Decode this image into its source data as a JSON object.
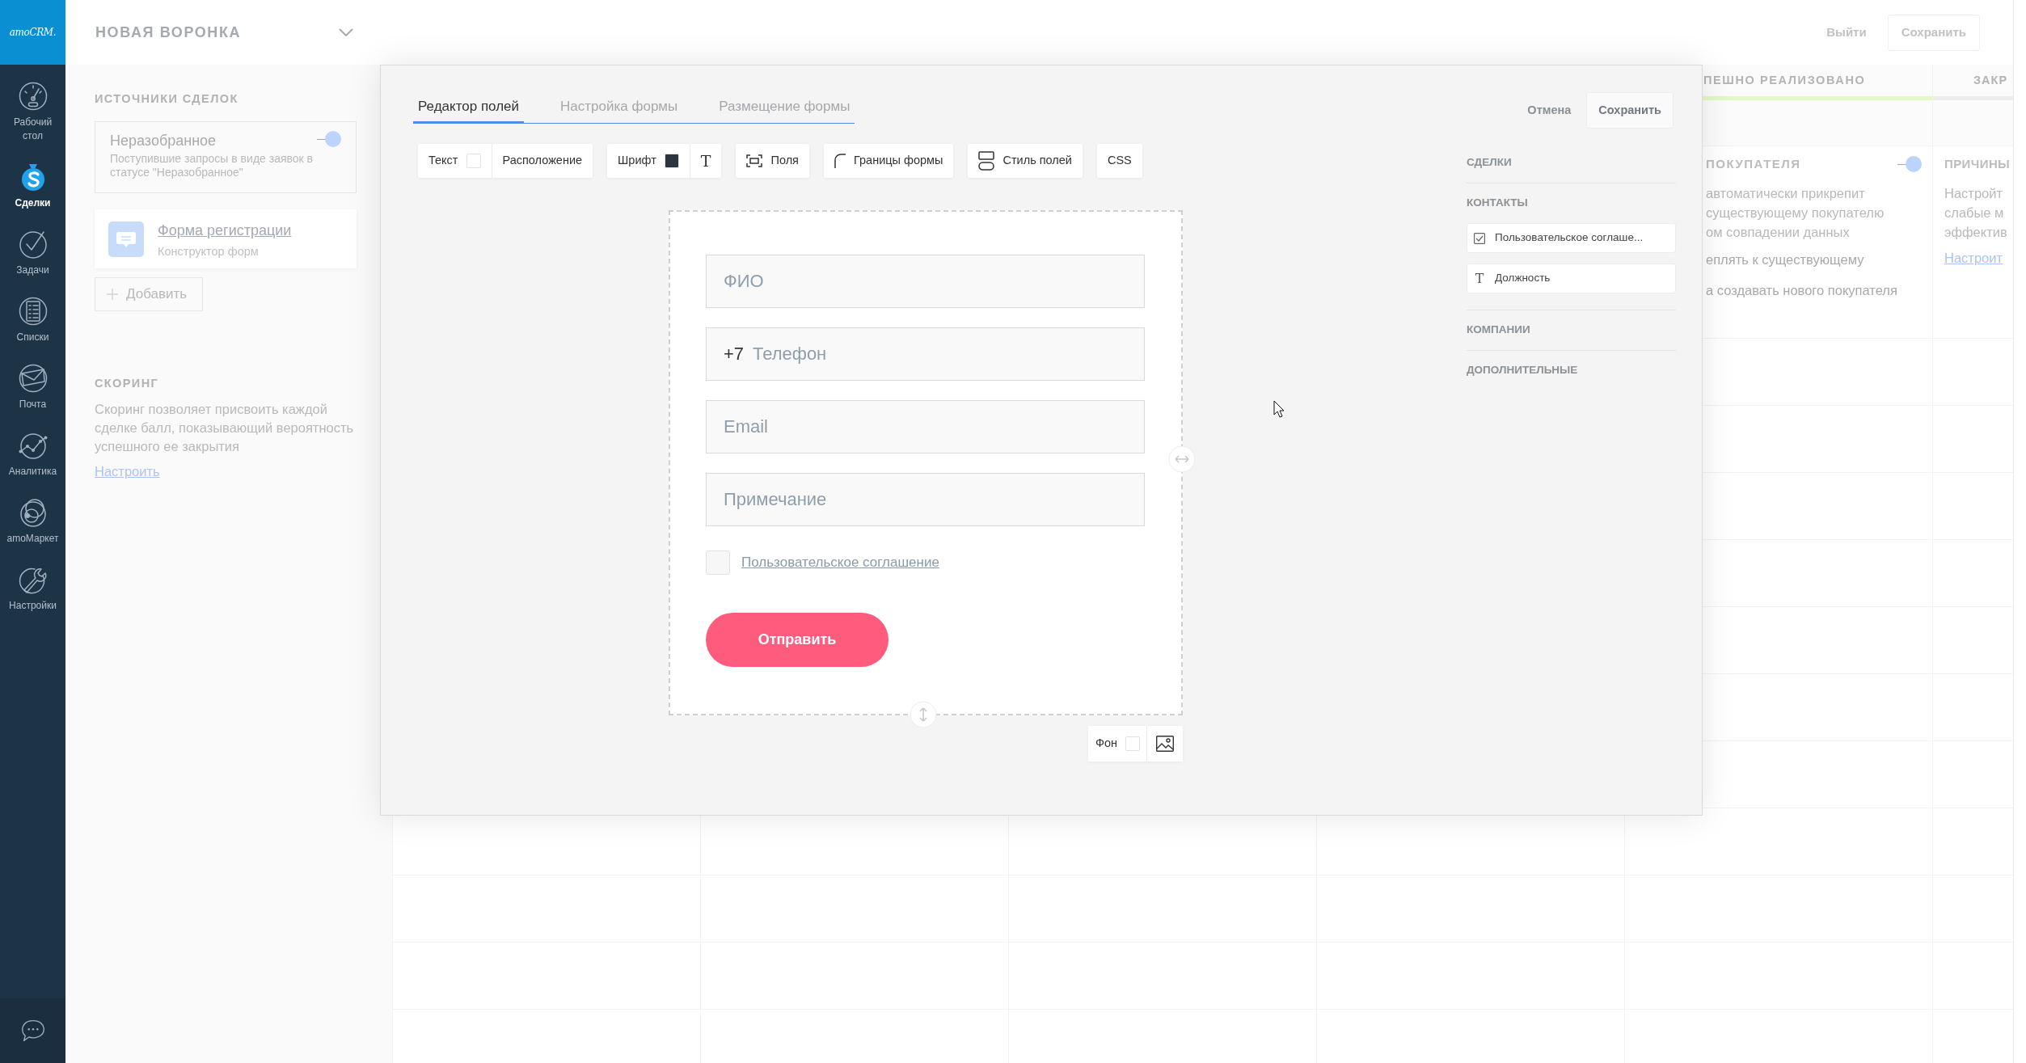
{
  "nav": {
    "logo": "amoCRM.",
    "items": [
      {
        "kind": "dashboard",
        "label": "Рабочий стол",
        "selected": false
      },
      {
        "kind": "deals",
        "label": "Сделки",
        "selected": true
      },
      {
        "kind": "tasks",
        "label": "Задачи",
        "selected": false
      },
      {
        "kind": "lists",
        "label": "Списки",
        "selected": false
      },
      {
        "kind": "mail",
        "label": "Почта",
        "selected": false
      },
      {
        "kind": "analytics",
        "label": "Аналитика",
        "selected": false
      },
      {
        "kind": "market",
        "label": "amoМаркет",
        "selected": false
      },
      {
        "kind": "settings",
        "label": "Настройки",
        "selected": false
      }
    ]
  },
  "pipeline_panel": {
    "title": "НОВАЯ ВОРОНКА",
    "sources_heading": "ИСТОЧНИКИ СДЕЛОК",
    "sources": [
      {
        "kind": "incoming",
        "title": "Неразобранное",
        "description": "Поступившие запросы в виде заявок в статусе \"Неразобранное\"",
        "on": true
      },
      {
        "kind": "form",
        "title": "Форма регистрации",
        "subtitle": "Конструктор форм"
      }
    ],
    "add_button": "Добавить",
    "scoring": {
      "heading": "СКОРИНГ",
      "text": "Скоринг позволяет присвоить каждой сделке балл, показывающий вероятность успешного ее закрытия",
      "link": "Настроить"
    }
  },
  "top_bar": {
    "exit": "Выйти",
    "save": "Сохранить"
  },
  "board": {
    "columns": [
      {
        "title": "ПЕШНО РЕАЛИЗОВАНО",
        "color": "#e4f8c6",
        "section": {
          "heading": "ПОКУПАТЕЛЯ",
          "on": true,
          "lines": [
            "автоматически прикрепит",
            "существующему покупателю",
            "ом совпадении данных"
          ],
          "options": [
            "еплять к существующему",
            "а создавать нового покупателя"
          ]
        }
      },
      {
        "title": "ЗАКР",
        "color": "#ececec",
        "section": {
          "heading": "ПРИЧИНЫ",
          "lines": [
            "Настройт",
            "слабые м",
            "эффектив"
          ],
          "link": "Настроит"
        }
      }
    ]
  },
  "form_editor": {
    "tabs": [
      {
        "label": "Редактор полей",
        "selected": true
      },
      {
        "label": "Настройка формы",
        "selected": false
      },
      {
        "label": "Размещение формы",
        "selected": false
      }
    ],
    "toolbar": [
      {
        "items": [
          {
            "kind": "swatch",
            "label": "Текст",
            "color": "#ffffff"
          },
          {
            "kind": "plain",
            "label": "Расположение"
          }
        ]
      },
      {
        "items": [
          {
            "kind": "swatch",
            "label": "Шрифт",
            "color": "#2c3440"
          },
          {
            "kind": "glyph",
            "label": "T"
          }
        ]
      },
      {
        "items": [
          {
            "kind": "fields",
            "label": "Поля"
          }
        ]
      },
      {
        "items": [
          {
            "kind": "borders",
            "label": "Границы формы"
          }
        ]
      },
      {
        "items": [
          {
            "kind": "field-style",
            "label": "Стиль полей"
          }
        ]
      },
      {
        "items": [
          {
            "kind": "plain",
            "label": "CSS"
          }
        ]
      }
    ],
    "cancel": "Отмена",
    "save": "Сохранить",
    "form": {
      "fields": [
        {
          "placeholder": "ФИО"
        },
        {
          "prefix": "+7",
          "placeholder": "Телефон"
        },
        {
          "placeholder": "Email"
        },
        {
          "placeholder": "Примечание"
        }
      ],
      "agreement": {
        "checked": false,
        "label": "Пользовательское соглашение"
      },
      "submit": "Отправить"
    },
    "background_control": {
      "label": "Фон",
      "color": "#ffffff"
    },
    "field_library": [
      {
        "heading": "СДЕЛКИ"
      },
      {
        "heading": "КОНТАКТЫ",
        "items": [
          {
            "kind": "checkbox",
            "label": "Пользовательское соглаше..."
          },
          {
            "kind": "text",
            "glyph": "T",
            "label": "Должность"
          }
        ]
      },
      {
        "heading": "КОМПАНИИ"
      },
      {
        "heading": "ДОПОЛНИТЕЛЬНЫЕ"
      }
    ]
  }
}
